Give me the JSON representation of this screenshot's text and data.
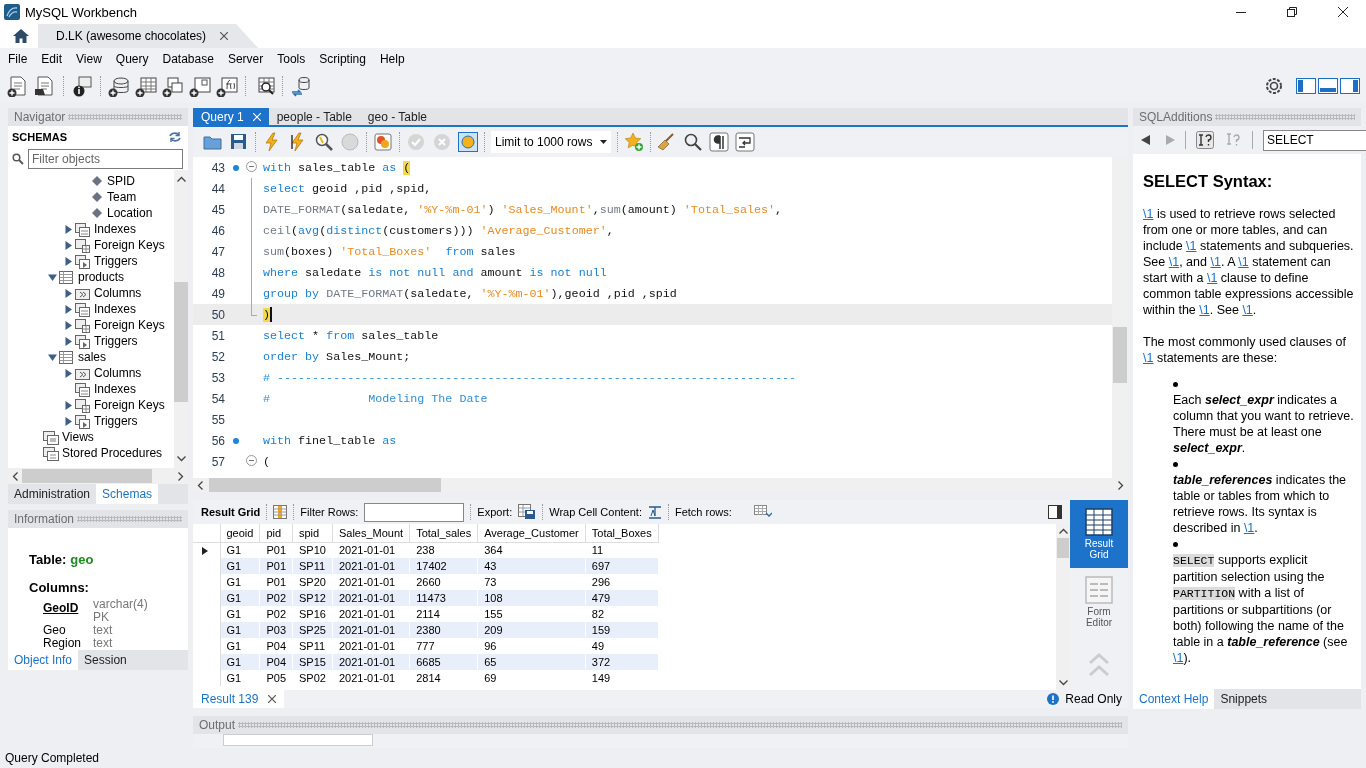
{
  "window": {
    "title": "MySQL Workbench"
  },
  "connection_tabs": [
    {
      "label": "D.LK (awesome chocolates)",
      "selected": true,
      "closable": true
    }
  ],
  "menu": [
    "File",
    "Edit",
    "View",
    "Query",
    "Database",
    "Server",
    "Tools",
    "Scripting",
    "Help"
  ],
  "navigator": {
    "title": "Navigator",
    "schemas_label": "SCHEMAS",
    "filter_placeholder": "Filter objects",
    "tree": [
      {
        "children": [
          {
            "children": [
              {
                "children": [
                  {
                    "label": "SPID",
                    "kind": "column"
                  },
                  {
                    "label": "Team",
                    "kind": "column"
                  },
                  {
                    "label": "Location",
                    "kind": "column"
                  }
                ]
              },
              {
                "label": "Indexes",
                "kind": "indexes",
                "expanded": false
              },
              {
                "label": "Foreign Keys",
                "kind": "foreign-keys",
                "expanded": false
              },
              {
                "label": "Triggers",
                "kind": "triggers",
                "expanded": false
              }
            ]
          },
          {
            "label": "products",
            "kind": "table",
            "expanded": true,
            "children": [
              {
                "label": "Columns",
                "kind": "columns",
                "expanded": false
              },
              {
                "label": "Indexes",
                "kind": "indexes",
                "expanded": false
              },
              {
                "label": "Foreign Keys",
                "kind": "foreign-keys",
                "expanded": false
              },
              {
                "label": "Triggers",
                "kind": "triggers",
                "expanded": false
              }
            ]
          },
          {
            "label": "sales",
            "kind": "table",
            "expanded": true,
            "children": [
              {
                "label": "Columns",
                "kind": "columns",
                "expanded": false
              },
              {
                "label": "Indexes",
                "kind": "indexes"
              },
              {
                "label": "Foreign Keys",
                "kind": "foreign-keys",
                "expanded": false
              },
              {
                "label": "Triggers",
                "kind": "triggers",
                "expanded": false
              }
            ]
          }
        ]
      },
      {
        "label": "Views",
        "kind": "views"
      },
      {
        "label": "Stored Procedures",
        "kind": "procedures"
      }
    ],
    "tabs": [
      {
        "label": "Administration",
        "selected": false
      },
      {
        "label": "Schemas",
        "selected": true
      }
    ]
  },
  "information": {
    "title": "Information",
    "table_label": "Table:",
    "table_name": "geo",
    "columns_label": "Columns:",
    "columns": [
      {
        "name": "GeoID",
        "type": "varchar(4)",
        "key": "PK",
        "primary": true
      },
      {
        "name": "Geo",
        "type": "text",
        "primary": false
      },
      {
        "name": "Region",
        "type": "text",
        "primary": false
      }
    ],
    "tabs": [
      {
        "label": "Object Info",
        "selected": true
      },
      {
        "label": "Session",
        "selected": false
      }
    ]
  },
  "editor_tabs": [
    {
      "label": "Query 1",
      "selected": true,
      "closable": true
    },
    {
      "label": "people - Table",
      "selected": false,
      "closable": false
    },
    {
      "label": "geo - Table",
      "selected": false,
      "closable": false
    }
  ],
  "editor": {
    "limit": "Limit to 1000 rows",
    "lines": [
      {
        "number": "43",
        "statement": true,
        "current": false,
        "fold_toggle": true,
        "in_fold": false,
        "tokens": [
          {
            "kind": "keyword",
            "text": "with"
          },
          {
            "kind": "plain",
            "text": " sales_table "
          },
          {
            "kind": "keyword",
            "text": "as "
          },
          {
            "kind": "match",
            "text": "("
          }
        ]
      },
      {
        "number": "44",
        "statement": false,
        "current": false,
        "fold_toggle": false,
        "in_fold": true,
        "tokens": [
          {
            "kind": "keyword",
            "text": "select"
          },
          {
            "kind": "plain",
            "text": " geoid ,pid ,spid,"
          }
        ]
      },
      {
        "number": "45",
        "statement": false,
        "current": false,
        "fold_toggle": false,
        "in_fold": true,
        "tokens": [
          {
            "kind": "function",
            "text": "DATE_FORMAT"
          },
          {
            "kind": "plain",
            "text": "(saledate, "
          },
          {
            "kind": "string",
            "text": "'%Y-%m-01'"
          },
          {
            "kind": "plain",
            "text": ") "
          },
          {
            "kind": "string",
            "text": "'Sales_Mount'"
          },
          {
            "kind": "plain",
            "text": ","
          },
          {
            "kind": "function",
            "text": "sum"
          },
          {
            "kind": "plain",
            "text": "(amount) "
          },
          {
            "kind": "string",
            "text": "'Total_sales'"
          },
          {
            "kind": "plain",
            "text": ","
          }
        ]
      },
      {
        "number": "46",
        "statement": false,
        "current": false,
        "fold_toggle": false,
        "in_fold": true,
        "tokens": [
          {
            "kind": "function",
            "text": "ceil"
          },
          {
            "kind": "plain",
            "text": "("
          },
          {
            "kind": "keyword",
            "text": "avg"
          },
          {
            "kind": "plain",
            "text": "("
          },
          {
            "kind": "keyword",
            "text": "distinct"
          },
          {
            "kind": "plain",
            "text": "(customers))) "
          },
          {
            "kind": "string",
            "text": "'Average_Customer'"
          },
          {
            "kind": "plain",
            "text": ","
          }
        ]
      },
      {
        "number": "47",
        "statement": false,
        "current": false,
        "fold_toggle": false,
        "in_fold": true,
        "tokens": [
          {
            "kind": "function",
            "text": "sum"
          },
          {
            "kind": "plain",
            "text": "(boxes) "
          },
          {
            "kind": "string",
            "text": "'Total_Boxes'  "
          },
          {
            "kind": "keyword",
            "text": "from"
          },
          {
            "kind": "plain",
            "text": " sales"
          }
        ]
      },
      {
        "number": "48",
        "statement": false,
        "current": false,
        "fold_toggle": false,
        "in_fold": true,
        "tokens": [
          {
            "kind": "keyword",
            "text": "where"
          },
          {
            "kind": "plain",
            "text": " saledate "
          },
          {
            "kind": "keyword",
            "text": "is not null and"
          },
          {
            "kind": "plain",
            "text": " amount "
          },
          {
            "kind": "keyword",
            "text": "is not null"
          }
        ]
      },
      {
        "number": "49",
        "statement": false,
        "current": false,
        "fold_toggle": false,
        "in_fold": true,
        "tokens": [
          {
            "kind": "keyword",
            "text": "group by "
          },
          {
            "kind": "function",
            "text": "DATE_FORMAT"
          },
          {
            "kind": "plain",
            "text": "(saledate, "
          },
          {
            "kind": "string",
            "text": "'%Y-%m-01'"
          },
          {
            "kind": "plain",
            "text": "),geoid ,pid ,spid"
          }
        ]
      },
      {
        "number": "50",
        "statement": false,
        "current": true,
        "fold_toggle": false,
        "in_fold": true,
        "tokens": [
          {
            "kind": "match",
            "text": ")"
          }
        ]
      },
      {
        "number": "51",
        "statement": false,
        "current": false,
        "fold_toggle": false,
        "in_fold": false,
        "tokens": [
          {
            "kind": "keyword",
            "text": "select"
          },
          {
            "kind": "plain",
            "text": " * "
          },
          {
            "kind": "keyword",
            "text": "from"
          },
          {
            "kind": "plain",
            "text": " sales_table"
          }
        ]
      },
      {
        "number": "52",
        "statement": false,
        "current": false,
        "fold_toggle": false,
        "in_fold": false,
        "tokens": [
          {
            "kind": "keyword",
            "text": "order by"
          },
          {
            "kind": "plain",
            "text": " Sales_Mount;"
          }
        ]
      },
      {
        "number": "53",
        "statement": false,
        "current": false,
        "fold_toggle": false,
        "in_fold": false,
        "tokens": [
          {
            "kind": "comment",
            "text": "# --------------------------------------------------------------------------"
          }
        ]
      },
      {
        "number": "54",
        "statement": false,
        "current": false,
        "fold_toggle": false,
        "in_fold": false,
        "tokens": [
          {
            "kind": "comment",
            "text": "#              Modeling The Date"
          }
        ]
      },
      {
        "number": "55",
        "statement": false,
        "current": false,
        "fold_toggle": false,
        "in_fold": false
      },
      {
        "number": "56",
        "statement": true,
        "current": false,
        "fold_toggle": false,
        "in_fold": false,
        "tokens": [
          {
            "kind": "keyword",
            "text": "with"
          },
          {
            "kind": "plain",
            "text": " finel_table "
          },
          {
            "kind": "keyword",
            "text": "as"
          }
        ]
      },
      {
        "number": "57",
        "statement": false,
        "current": false,
        "fold_toggle": true,
        "in_fold": false,
        "tokens": [
          {
            "kind": "plain",
            "text": "("
          }
        ]
      }
    ]
  },
  "results": {
    "toolbar": {
      "title": "Result Grid",
      "filter_label": "Filter Rows:",
      "export_label": "Export:",
      "wrap_label": "Wrap Cell Content:",
      "fetch_label": "Fetch rows:"
    },
    "columns": [
      "geoid",
      "pid",
      "spid",
      "Sales_Mount",
      "Total_sales",
      "Average_Customer",
      "Total_Boxes"
    ],
    "rows": [
      {
        "selected": true,
        "cells": [
          "G1",
          "P01",
          "SP10",
          "2021-01-01",
          "238",
          "364",
          "11"
        ]
      },
      {
        "selected": false,
        "cells": [
          "G1",
          "P01",
          "SP11",
          "2021-01-01",
          "17402",
          "43",
          "697"
        ]
      },
      {
        "selected": false,
        "cells": [
          "G1",
          "P01",
          "SP20",
          "2021-01-01",
          "2660",
          "73",
          "296"
        ]
      },
      {
        "selected": false,
        "cells": [
          "G1",
          "P02",
          "SP12",
          "2021-01-01",
          "11473",
          "108",
          "479"
        ]
      },
      {
        "selected": false,
        "cells": [
          "G1",
          "P02",
          "SP16",
          "2021-01-01",
          "2114",
          "155",
          "82"
        ]
      },
      {
        "selected": false,
        "cells": [
          "G1",
          "P03",
          "SP25",
          "2021-01-01",
          "2380",
          "209",
          "159"
        ]
      },
      {
        "selected": false,
        "cells": [
          "G1",
          "P04",
          "SP11",
          "2021-01-01",
          "777",
          "96",
          "49"
        ]
      },
      {
        "selected": false,
        "cells": [
          "G1",
          "P04",
          "SP15",
          "2021-01-01",
          "6685",
          "65",
          "372"
        ]
      },
      {
        "selected": false,
        "cells": [
          "G1",
          "P05",
          "SP02",
          "2021-01-01",
          "2814",
          "69",
          "149"
        ]
      }
    ],
    "side_buttons": [
      {
        "label": "Result Grid",
        "selected": true
      },
      {
        "label": "Form Editor",
        "selected": false
      }
    ],
    "tabs": [
      {
        "label": "Result 139",
        "selected": true,
        "closable": true
      }
    ],
    "status": "Read Only"
  },
  "output": {
    "title": "Output"
  },
  "sql_additions": {
    "title": "SQLAdditions",
    "search_value": "SELECT",
    "heading": "SELECT Syntax:",
    "paragraphs": [
      [
        {
          "kind": "link",
          "text": "\\1"
        },
        {
          "kind": "text",
          "text": " is used to retrieve rows selected from one or more tables, and can include "
        },
        {
          "kind": "link",
          "text": "\\1"
        },
        {
          "kind": "text",
          "text": " statements and subqueries. See "
        },
        {
          "kind": "link",
          "text": "\\1"
        },
        {
          "kind": "text",
          "text": ", and "
        },
        {
          "kind": "link",
          "text": "\\1"
        },
        {
          "kind": "text",
          "text": ". A "
        },
        {
          "kind": "link",
          "text": "\\1"
        },
        {
          "kind": "text",
          "text": " statement can start with a "
        },
        {
          "kind": "link",
          "text": "\\1"
        },
        {
          "kind": "text",
          "text": " clause to define common table expressions accessible within the "
        },
        {
          "kind": "link",
          "text": "\\1"
        },
        {
          "kind": "text",
          "text": ". See "
        },
        {
          "kind": "link",
          "text": "\\1"
        },
        {
          "kind": "text",
          "text": "."
        }
      ],
      [
        {
          "kind": "text",
          "text": "The most commonly used clauses of "
        },
        {
          "kind": "link",
          "text": "\\1"
        },
        {
          "kind": "text",
          "text": " statements are these:"
        }
      ]
    ],
    "list_items": [
      [
        {
          "kind": "text",
          "text": "Each "
        },
        {
          "kind": "term",
          "text": "select_expr"
        },
        {
          "kind": "text",
          "text": " indicates a column that you want to retrieve. There must be at least one "
        },
        {
          "kind": "term",
          "text": "select_expr"
        },
        {
          "kind": "text",
          "text": "."
        }
      ],
      [
        {
          "kind": "term",
          "text": "table_references"
        },
        {
          "kind": "text",
          "text": " indicates the table or tables from which to retrieve rows. Its syntax is described in "
        },
        {
          "kind": "link",
          "text": "\\1"
        },
        {
          "kind": "text",
          "text": "."
        }
      ],
      [
        {
          "kind": "code",
          "text": "SELECT"
        },
        {
          "kind": "text",
          "text": " supports explicit partition selection using the "
        },
        {
          "kind": "code",
          "text": "PARTITION"
        },
        {
          "kind": "text",
          "text": " with a list of partitions or subpartitions (or both) following the name of the table in a "
        },
        {
          "kind": "term",
          "text": "table_reference"
        },
        {
          "kind": "text",
          "text": " (see "
        },
        {
          "kind": "link",
          "text": "\\1"
        },
        {
          "kind": "text",
          "text": ")."
        }
      ]
    ],
    "tabs": [
      {
        "label": "Context Help",
        "selected": true
      },
      {
        "label": "Snippets",
        "selected": false
      }
    ]
  },
  "status_bar": "Query Completed"
}
